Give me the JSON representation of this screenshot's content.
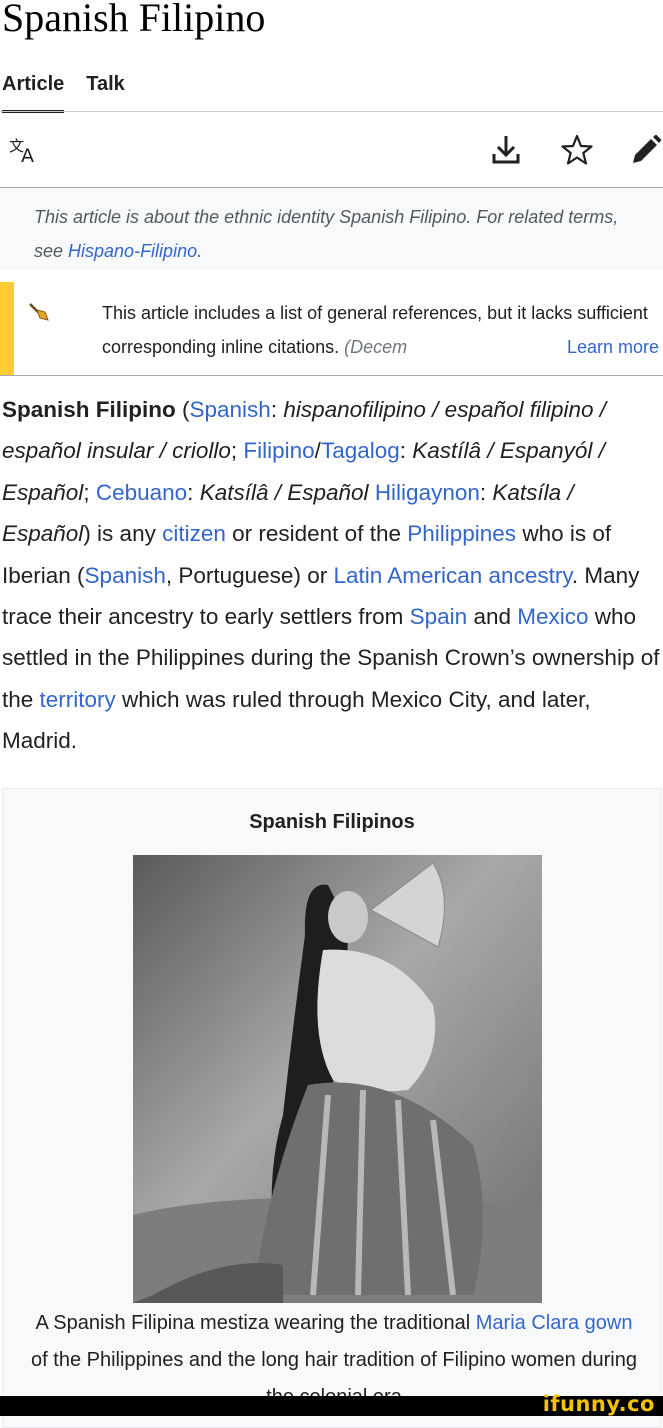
{
  "page": {
    "title": "Spanish Filipino",
    "tabs": [
      {
        "label": "Article",
        "active": true
      },
      {
        "label": "Talk",
        "active": false
      }
    ]
  },
  "toolbar": {
    "icons": [
      "language-icon",
      "download-icon",
      "star-icon",
      "edit-pencil-icon"
    ]
  },
  "hatnote": {
    "text": "This article is about the ethnic identity Spanish Filipino. For related terms, see ",
    "link": "Hispano-Filipino",
    "suffix": "."
  },
  "notice": {
    "text": "This article includes a list of general references, but it lacks sufficient corresponding inline citations.",
    "date": "(Decem",
    "learn_more": "Learn more",
    "icon": "broom-icon",
    "accent_color": "#ffcc33"
  },
  "lead": {
    "t01": "Spanish Filipino",
    "t02": " (",
    "l01": "Spanish",
    "t03": ": ",
    "i01": "hispanofilipino / español filipino / español insular / criollo",
    "t04": "; ",
    "l02": "Filipino",
    "t05": "/",
    "l03": "Tagalog",
    "t06": ": ",
    "i02": "Kastílâ / Espanyól / Español",
    "t07": "; ",
    "l04": "Cebuano",
    "t08": ": ",
    "i03": "Katsílâ / Español",
    "t09": " ",
    "l05": "Hiligaynon",
    "t10": ": ",
    "i04": "Katsíla / Español",
    "t11": ") is any ",
    "l06": "citizen",
    "t12": " or resident of the ",
    "l07": "Philippines",
    "t13": " who is of Iberian (",
    "l08": "Spanish",
    "t14": ", Portuguese) or ",
    "l09": "Latin American ancestry",
    "t15": ". Many trace their ancestry to early settlers from ",
    "l10": "Spain",
    "t16": " and ",
    "l11": "Mexico",
    "t17": " who settled in the Philippines during the Spanish Crown’s ownership of the ",
    "l12": "territory",
    "t18": " which was ruled through Mexico City, and later, Madrid."
  },
  "infobox": {
    "title": "Spanish Filipinos",
    "caption_a": "A Spanish Filipina mestiza wearing the traditional ",
    "caption_link": "Maria Clara gown",
    "caption_b": " of the Philippines and the long hair tradition of Filipino women during the colonial era"
  },
  "watermark": {
    "text": "ifunny.co"
  },
  "colors": {
    "link": "#3366cc",
    "text": "#202122",
    "infobox_bg": "#f8f9fa",
    "hatnote_bg": "#f8f9fa"
  }
}
